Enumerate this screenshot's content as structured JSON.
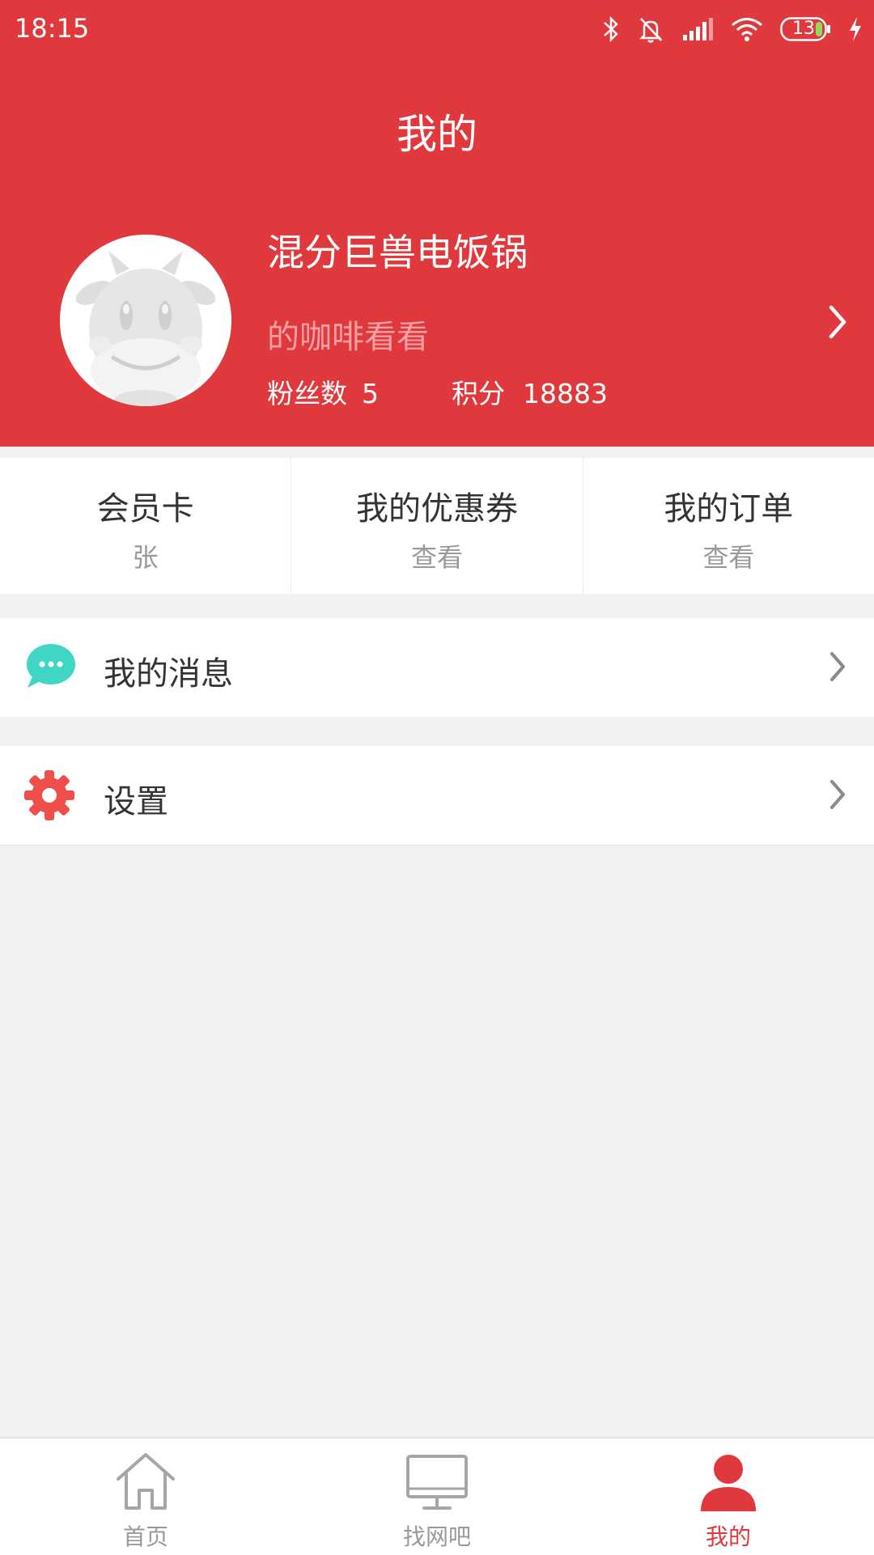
{
  "status_bar": {
    "time": "18:15",
    "battery": "13"
  },
  "header": {
    "title": "我的",
    "user_name": "混分巨兽电饭锅",
    "signature": "的咖啡看看",
    "fans_label": "粉丝数",
    "fans_value": "5",
    "points_label": "积分",
    "points_value": "18883"
  },
  "quick_links": [
    {
      "title": "会员卡",
      "sub": "张"
    },
    {
      "title": "我的优惠券",
      "sub": "查看"
    },
    {
      "title": "我的订单",
      "sub": "查看"
    }
  ],
  "menu": [
    {
      "label": "我的消息",
      "icon": "chat-bubble-icon",
      "color": "#3fd6c6"
    },
    {
      "label": "设置",
      "icon": "gear-icon",
      "color": "#ef4e4a"
    }
  ],
  "tabbar": {
    "tabs": [
      {
        "label": "首页",
        "icon": "home-icon",
        "active": false
      },
      {
        "label": "找网吧",
        "icon": "monitor-icon",
        "active": false
      },
      {
        "label": "我的",
        "icon": "person-icon",
        "active": true
      }
    ]
  },
  "colors": {
    "primary": "#e0393d",
    "signature": "#f6a0a2",
    "background": "#f2f2f2"
  }
}
